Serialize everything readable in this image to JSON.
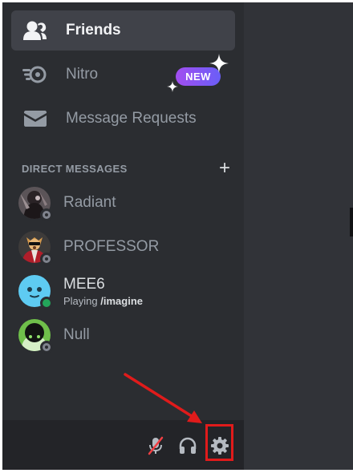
{
  "nav": {
    "friends_label": "Friends",
    "nitro_label": "Nitro",
    "nitro_badge": "NEW",
    "requests_label": "Message Requests"
  },
  "direct_messages": {
    "title": "DIRECT MESSAGES",
    "add_icon": "plus-icon",
    "items": [
      {
        "name": "Radiant",
        "status": "offline",
        "subtitle_prefix": "",
        "subtitle_value": ""
      },
      {
        "name": "PROFESSOR",
        "status": "offline",
        "subtitle_prefix": "",
        "subtitle_value": ""
      },
      {
        "name": "MEE6",
        "status": "online",
        "subtitle_prefix": "Playing ",
        "subtitle_value": "/imagine"
      },
      {
        "name": "Null",
        "status": "offline",
        "subtitle_prefix": "",
        "subtitle_value": ""
      }
    ]
  },
  "user_bar": {
    "buttons": [
      "muted-microphone-icon",
      "headphones-icon",
      "gear-icon"
    ]
  },
  "colors": {
    "sidebar_bg": "#2b2d31",
    "content_bg": "#313338",
    "active_item_bg": "#404249",
    "online": "#23a55a",
    "offline": "#80848e",
    "annotation_red": "#e01b1b",
    "nitro_gradient_start": "#a24ef0",
    "nitro_gradient_end": "#6a5ef7"
  }
}
